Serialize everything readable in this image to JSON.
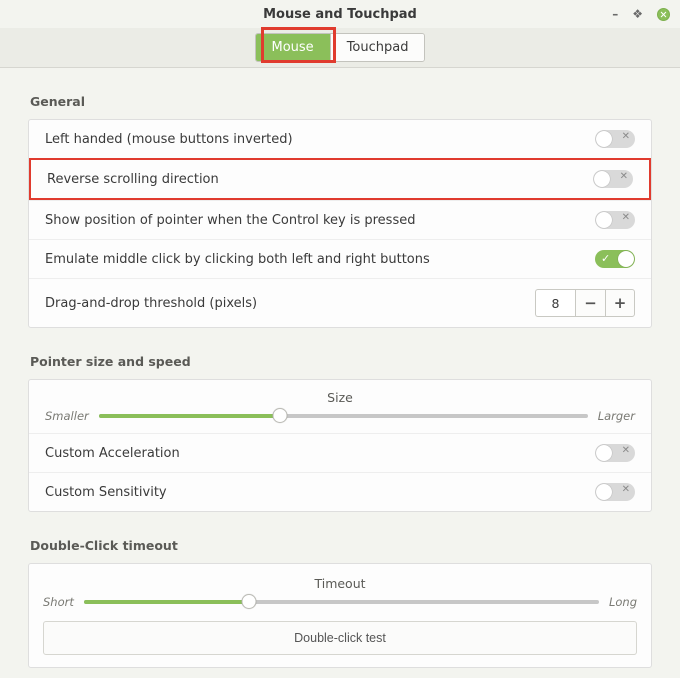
{
  "window": {
    "title": "Mouse and Touchpad",
    "min_glyph": "–",
    "max_glyph": "❖"
  },
  "tabs": {
    "mouse": "Mouse",
    "touchpad": "Touchpad"
  },
  "general": {
    "heading": "General",
    "left_handed": "Left handed (mouse buttons inverted)",
    "reverse_scroll": "Reverse scrolling direction",
    "show_pointer_ctrl": "Show position of pointer when the Control key is pressed",
    "emulate_middle": "Emulate middle click by clicking both left and right buttons",
    "dnd_threshold_label": "Drag-and-drop threshold (pixels)",
    "dnd_value": "8"
  },
  "pointer": {
    "heading": "Pointer size and speed",
    "size_label": "Size",
    "size_left": "Smaller",
    "size_right": "Larger",
    "custom_accel": "Custom Acceleration",
    "custom_sens": "Custom Sensitivity"
  },
  "doubleclick": {
    "heading": "Double-Click timeout",
    "timeout_label": "Timeout",
    "timeout_left": "Short",
    "timeout_right": "Long",
    "test_label": "Double-click test"
  },
  "sliders": {
    "size_percent": 37,
    "timeout_percent": 32
  }
}
